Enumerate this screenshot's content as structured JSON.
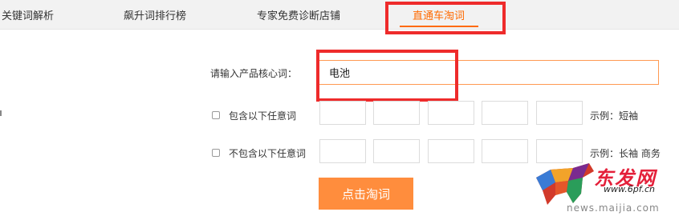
{
  "tabs": [
    {
      "label": "关键词解析"
    },
    {
      "label": "飙升词排行榜"
    },
    {
      "label": "专家免费诊断店铺"
    },
    {
      "label": "直通车淘词"
    }
  ],
  "form": {
    "core_label": "请输入产品核心词：",
    "core_value": "电池",
    "include_label": "包含以下任意词",
    "include_example": "示例：短袖",
    "exclude_label": "不包含以下任意词",
    "exclude_example": "示例：长袖 商务",
    "submit_label": "点击淘词"
  },
  "watermark": {
    "brand": "东发网",
    "url_short": "www.6pf.cn",
    "url_long": "news.maijia.com"
  },
  "colors": {
    "accent": "#ff6a00",
    "button": "#ff8d3d",
    "highlight": "#ee2b2b"
  }
}
